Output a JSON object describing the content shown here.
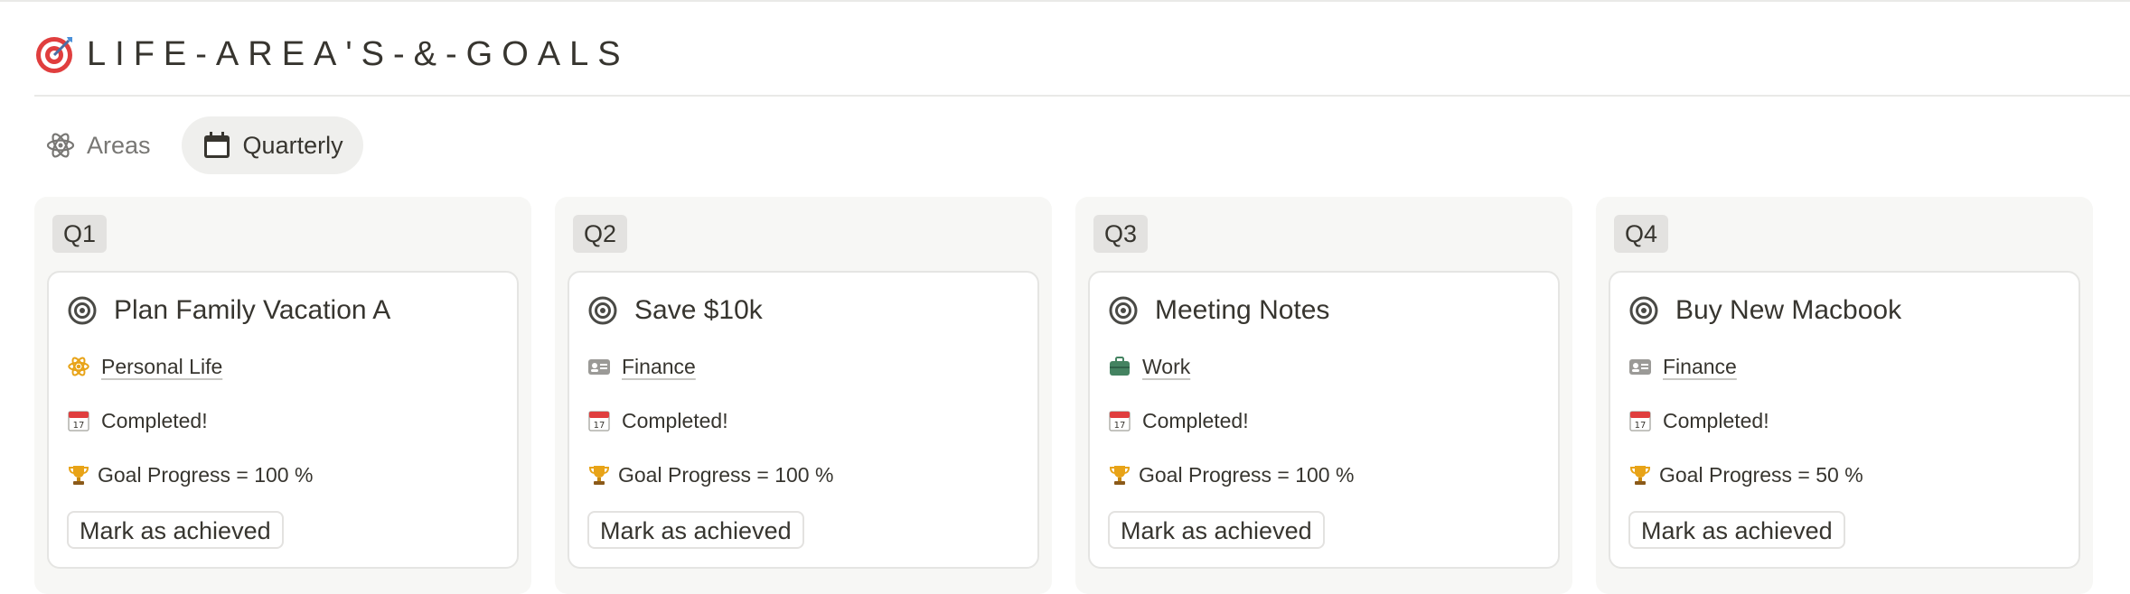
{
  "header": {
    "title": "LIFE-AREA'S-&-GOALS"
  },
  "tabs": [
    {
      "label": "Areas"
    },
    {
      "label": "Quarterly"
    }
  ],
  "columns": [
    {
      "badge": "Q1",
      "card": {
        "title": "Plan Family Vacation  A",
        "area": "Personal Life",
        "area_icon": "atom-icon",
        "status": "Completed!",
        "progress": "Goal Progress = 100 %",
        "button": "Mark as achieved"
      }
    },
    {
      "badge": "Q2",
      "card": {
        "title": "Save $10k",
        "area": "Finance",
        "area_icon": "id-card-icon",
        "status": "Completed!",
        "progress": "Goal Progress = 100 %",
        "button": "Mark as achieved"
      }
    },
    {
      "badge": "Q3",
      "card": {
        "title": "Meeting Notes",
        "area": "Work",
        "area_icon": "briefcase-icon",
        "status": "Completed!",
        "progress": "Goal Progress = 100 %",
        "button": "Mark as achieved"
      }
    },
    {
      "badge": "Q4",
      "card": {
        "title": "Buy New Macbook",
        "area": "Finance",
        "area_icon": "id-card-icon",
        "status": "Completed!",
        "progress": "Goal Progress = 50 %",
        "button": "Mark as achieved"
      }
    }
  ],
  "colors": {
    "accent_red": "#e03e3e",
    "trophy_gold": "#e8a317",
    "work_green": "#448361",
    "text": "#37352f"
  }
}
